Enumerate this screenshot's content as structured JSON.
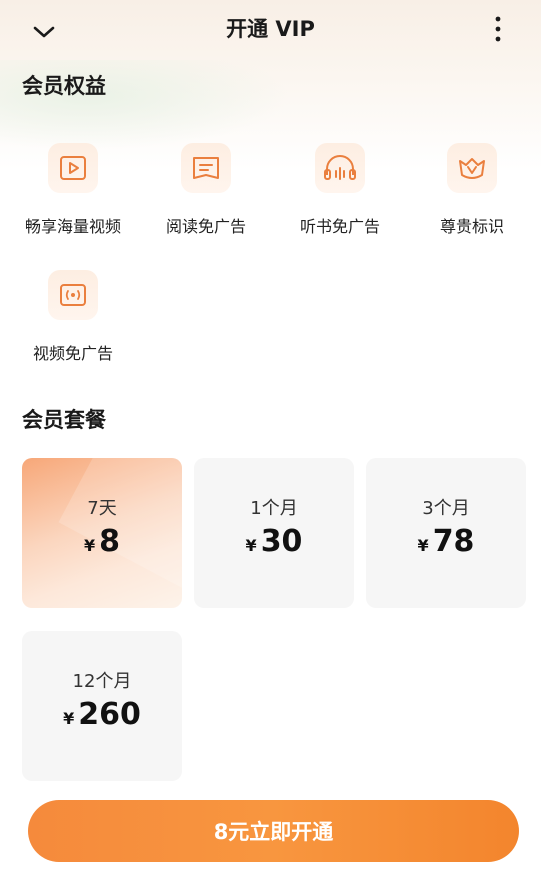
{
  "header": {
    "title": "开通 VIP",
    "back_icon": "chevron-down-icon",
    "more_icon": "more-vertical-icon"
  },
  "benefits": {
    "title": "会员权益",
    "items": [
      {
        "label": "畅享海量视频",
        "icon": "video-play-icon"
      },
      {
        "label": "阅读免广告",
        "icon": "book-icon"
      },
      {
        "label": "听书免广告",
        "icon": "headphones-icon"
      },
      {
        "label": "尊贵标识",
        "icon": "crown-badge-icon"
      },
      {
        "label": "视频免广告",
        "icon": "video-broadcast-icon"
      }
    ]
  },
  "plans": {
    "title": "会员套餐",
    "currency": "¥",
    "items": [
      {
        "duration": "7天",
        "price": "8",
        "selected": true
      },
      {
        "duration": "1个月",
        "price": "30",
        "selected": false
      },
      {
        "duration": "3个月",
        "price": "78",
        "selected": false
      },
      {
        "duration": "12个月",
        "price": "260",
        "selected": false
      }
    ]
  },
  "cta": {
    "label": "8元立即开通"
  },
  "colors": {
    "accent": "#f58a3c",
    "icon_stroke": "#ea7f3e",
    "card_bg": "#f6f6f6"
  }
}
